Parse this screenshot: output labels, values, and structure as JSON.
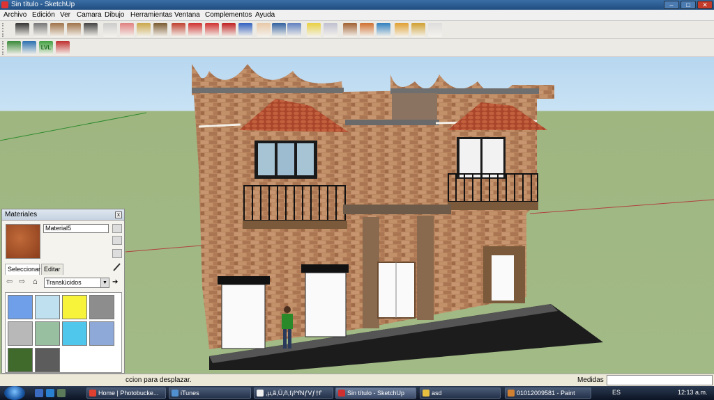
{
  "window": {
    "title": "Sin título - SketchUp",
    "min": "–",
    "max": "□",
    "close": "✕"
  },
  "menu": [
    "Archivo",
    "Edición",
    "Ver",
    "Camara",
    "Dibujo",
    "Herramientas",
    "Ventana",
    "Complementos",
    "Ayuda"
  ],
  "toolbar1": [
    {
      "name": "select-tool",
      "color": "#333"
    },
    {
      "name": "pencil-tool",
      "color": "#777"
    },
    {
      "name": "rectangle-tool",
      "color": "#a0734a"
    },
    {
      "name": "circle-tool",
      "color": "#a0734a"
    },
    {
      "name": "arc-tool",
      "color": "#444"
    },
    {
      "name": "make-component-tool",
      "color": "#ccc"
    },
    {
      "name": "eraser-tool",
      "color": "#e08080"
    },
    {
      "name": "tape-measure-tool",
      "color": "#caa74a"
    },
    {
      "name": "paint-bucket-tool",
      "color": "#7a5a30"
    },
    {
      "name": "push-pull-tool",
      "color": "#c04030"
    },
    {
      "name": "move-tool",
      "color": "#d03030"
    },
    {
      "name": "rotate-tool",
      "color": "#d03030"
    },
    {
      "name": "offset-tool",
      "color": "#c02020"
    },
    {
      "name": "orbit-tool",
      "color": "#3060c0"
    },
    {
      "name": "pan-tool",
      "color": "#e8c8a8"
    },
    {
      "name": "zoom-tool",
      "color": "#3060a0"
    },
    {
      "name": "zoom-extents-tool",
      "color": "#6080c0"
    },
    {
      "name": "add-location-tool",
      "color": "#e8d040"
    },
    {
      "name": "toggle-terrain-tool",
      "color": "#c0c0d0"
    },
    {
      "name": "get-models-tool",
      "color": "#a06030"
    },
    {
      "name": "share-model-tool",
      "color": "#d07030"
    },
    {
      "name": "google-earth-tool",
      "color": "#3080c0"
    },
    {
      "name": "get-components-tool",
      "color": "#e0a030"
    },
    {
      "name": "share-component-tool",
      "color": "#d0a030"
    },
    {
      "name": "3d-warehouse-tool",
      "color": "#ddd"
    }
  ],
  "toolbar2": [
    {
      "name": "sandbox-tool",
      "color": "#3a8a3a"
    },
    {
      "name": "location-tool",
      "color": "#2a70b0"
    },
    {
      "name": "level-tool",
      "color": "#40a040"
    },
    {
      "name": "section-tool",
      "color": "#c03030"
    }
  ],
  "level_text": "LVL",
  "materials": {
    "title": "Materiales",
    "close": "x",
    "name_value": "Material5",
    "tabs": [
      "Seleccionar",
      "Editar"
    ],
    "back": "⇦",
    "forward": "⇨",
    "home": "⌂",
    "collection": "Translúcidos",
    "collection_arrow": "▼",
    "details": "➔",
    "swatches": [
      "#6f9fe8",
      "#bfe0ee",
      "#f6f33a",
      "#8d8d8d",
      "#b8b8b8",
      "#98c0a0",
      "#4fc6ec",
      "#8ea8d8",
      "#3f6a2c",
      "#5c5c5c"
    ]
  },
  "status": {
    "text": "ccion para desplazar.",
    "measure_label": "Medidas",
    "measure_value": ""
  },
  "taskbar": {
    "buttons": [
      {
        "label": "Home | Photobucke...",
        "icon_color": "#e04030"
      },
      {
        "label": "iTunes",
        "icon_color": "#5090d0"
      },
      {
        "label": ",µ,ã,Ü,ñ,f¡f^fNƒVƒ†f'",
        "icon_color": "#f0f0f0"
      },
      {
        "label": "Sin título - SketchUp",
        "icon_color": "#d03030"
      },
      {
        "label": "asd",
        "icon_color": "#e8c040"
      },
      {
        "label": "01012009581 - Paint",
        "icon_color": "#d08030"
      }
    ],
    "lang": "ES",
    "clock": "12:13 a.m."
  }
}
